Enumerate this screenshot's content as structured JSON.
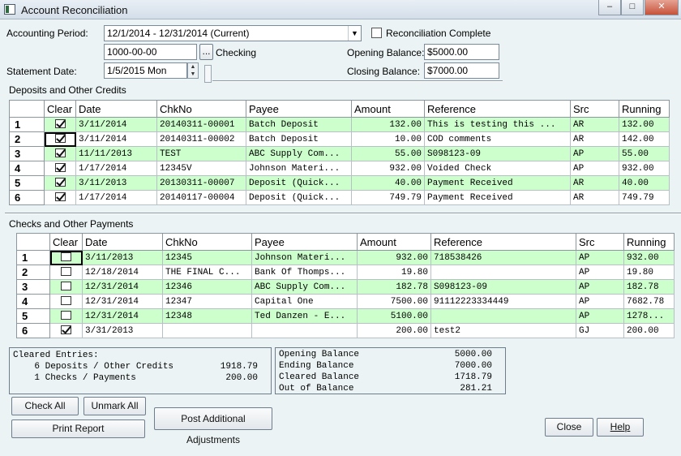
{
  "window": {
    "title": "Account Reconciliation"
  },
  "top": {
    "accounting_period_label": "Accounting Period:",
    "accounting_period_value": "12/1/2014 - 12/31/2014 (Current)",
    "reconciliation_complete_label": "Reconciliation Complete",
    "account_number": "1000-00-00",
    "browse_label": "...",
    "account_name": "Checking",
    "opening_balance_label": "Opening Balance:",
    "opening_balance_value": "$5000.00",
    "statement_date_label": "Statement Date:",
    "statement_date_value": "1/5/2015 Mon",
    "closing_balance_label": "Closing Balance:",
    "closing_balance_value": "$7000.00"
  },
  "deposits": {
    "section_label": "Deposits and Other Credits",
    "columns": [
      "Clear",
      "Date",
      "ChkNo",
      "Payee",
      "Amount",
      "Reference",
      "Src",
      "Running"
    ],
    "rows": [
      {
        "n": "1",
        "clear": true,
        "date": "3/11/2014",
        "chkno": "20140311-00001",
        "payee": "Batch Deposit",
        "amount": "132.00",
        "reference": "This is testing this ...",
        "src": "AR",
        "running": "132.00",
        "hl": true
      },
      {
        "n": "2",
        "clear": true,
        "date": "3/11/2014",
        "chkno": "20140311-00002",
        "payee": "Batch Deposit",
        "amount": "10.00",
        "reference": "COD comments",
        "src": "AR",
        "running": "142.00",
        "hl": false
      },
      {
        "n": "3",
        "clear": true,
        "date": "11/11/2013",
        "chkno": "TEST",
        "payee": "ABC Supply Com...",
        "amount": "55.00",
        "reference": "S098123-09",
        "src": "AP",
        "running": "55.00",
        "hl": true
      },
      {
        "n": "4",
        "clear": true,
        "date": "1/17/2014",
        "chkno": "12345V",
        "payee": "Johnson Materi...",
        "amount": "932.00",
        "reference": "Voided Check",
        "src": "AP",
        "running": "932.00",
        "hl": false
      },
      {
        "n": "5",
        "clear": true,
        "date": "3/11/2013",
        "chkno": "20130311-00007",
        "payee": "Deposit (Quick...",
        "amount": "40.00",
        "reference": "Payment Received",
        "src": "AR",
        "running": "40.00",
        "hl": true
      },
      {
        "n": "6",
        "clear": true,
        "date": "1/17/2014",
        "chkno": "20140117-00004",
        "payee": "Deposit (Quick...",
        "amount": "749.79",
        "reference": "Payment Received",
        "src": "AR",
        "running": "749.79",
        "hl": false
      }
    ]
  },
  "checks": {
    "section_label": "Checks and Other Payments",
    "columns": [
      "Clear",
      "Date",
      "ChkNo",
      "Payee",
      "Amount",
      "Reference",
      "Src",
      "Running"
    ],
    "rows": [
      {
        "n": "1",
        "clear": false,
        "date": "3/11/2013",
        "chkno": "12345",
        "payee": "Johnson Materi...",
        "amount": "932.00",
        "reference": "718538426",
        "src": "AP",
        "running": "932.00",
        "hl": true
      },
      {
        "n": "2",
        "clear": false,
        "date": "12/18/2014",
        "chkno": "THE FINAL C...",
        "payee": "Bank Of Thomps...",
        "amount": "19.80",
        "reference": "",
        "src": "AP",
        "running": "19.80",
        "hl": false
      },
      {
        "n": "3",
        "clear": false,
        "date": "12/31/2014",
        "chkno": "12346",
        "payee": "ABC Supply Com...",
        "amount": "182.78",
        "reference": "S098123-09",
        "src": "AP",
        "running": "182.78",
        "hl": true
      },
      {
        "n": "4",
        "clear": false,
        "date": "12/31/2014",
        "chkno": "12347",
        "payee": "Capital One",
        "amount": "7500.00",
        "reference": "91112223334449",
        "src": "AP",
        "running": "7682.78",
        "hl": false
      },
      {
        "n": "5",
        "clear": false,
        "date": "12/31/2014",
        "chkno": "12348",
        "payee": "Ted Danzen - E...",
        "amount": "5100.00",
        "reference": "",
        "src": "AP",
        "running": "1278...",
        "hl": true
      },
      {
        "n": "6",
        "clear": true,
        "date": "3/31/2013",
        "chkno": "",
        "payee": "",
        "amount": "200.00",
        "reference": "test2",
        "src": "GJ",
        "running": "200.00",
        "hl": false
      }
    ]
  },
  "cleared": {
    "title": "Cleared Entries:",
    "deposits_text": "6 Deposits / Other Credits",
    "deposits_value": "1918.79",
    "checks_text": "1 Checks / Payments",
    "checks_value": "200.00"
  },
  "balances": [
    {
      "label": "Opening Balance",
      "value": "5000.00"
    },
    {
      "label": "Ending Balance",
      "value": "7000.00"
    },
    {
      "label": "Cleared Balance",
      "value": "1718.79"
    },
    {
      "label": "Out of Balance",
      "value": "281.21"
    }
  ],
  "buttons": {
    "check_all": "Check All",
    "unmark_all": "Unmark All",
    "print_report": "Print Report",
    "post_adjustments": "Post Additional Adjustments",
    "close": "Close",
    "help": "Help"
  }
}
